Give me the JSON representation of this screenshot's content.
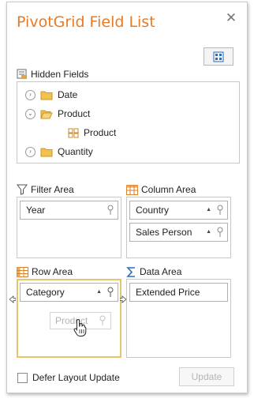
{
  "window": {
    "title": "PivotGrid Field List",
    "close_glyph": "✕"
  },
  "hidden_fields": {
    "label": "Hidden Fields",
    "tree": [
      {
        "label": "Date",
        "expander": "collapsed"
      },
      {
        "label": "Product",
        "expander": "expanded"
      },
      {
        "label": "Product",
        "expander": "none"
      },
      {
        "label": "Quantity",
        "expander": "collapsed"
      }
    ]
  },
  "filter_area": {
    "label": "Filter Area",
    "fields": [
      {
        "label": "Year"
      }
    ]
  },
  "column_area": {
    "label": "Column Area",
    "fields": [
      {
        "label": "Country",
        "sort": "▲"
      },
      {
        "label": "Sales Person",
        "sort": "▲"
      }
    ]
  },
  "row_area": {
    "label": "Row Area",
    "fields": [
      {
        "label": "Category",
        "sort": "▲"
      }
    ],
    "drag_ghost": "Product"
  },
  "data_area": {
    "label": "Data Area",
    "fields": [
      {
        "label": "Extended Price"
      }
    ]
  },
  "footer": {
    "defer_label": "Defer Layout Update",
    "defer_checked": false,
    "update_label": "Update"
  },
  "colors": {
    "title": "#e87a25",
    "active_area_border": "#e3c76b",
    "folder": "#f2c14e"
  },
  "icons": {
    "close": "close-icon",
    "layout": "layout-grid-icon",
    "hidden_fields": "field-list-icon",
    "folder": "folder-icon",
    "field": "field-icon",
    "filter_area": "funnel-icon",
    "column_area": "table-columns-icon",
    "row_area": "table-rows-icon",
    "data_area": "sigma-icon",
    "field_filter": "filter-pin-icon",
    "cursor": "hand-cursor-icon"
  }
}
